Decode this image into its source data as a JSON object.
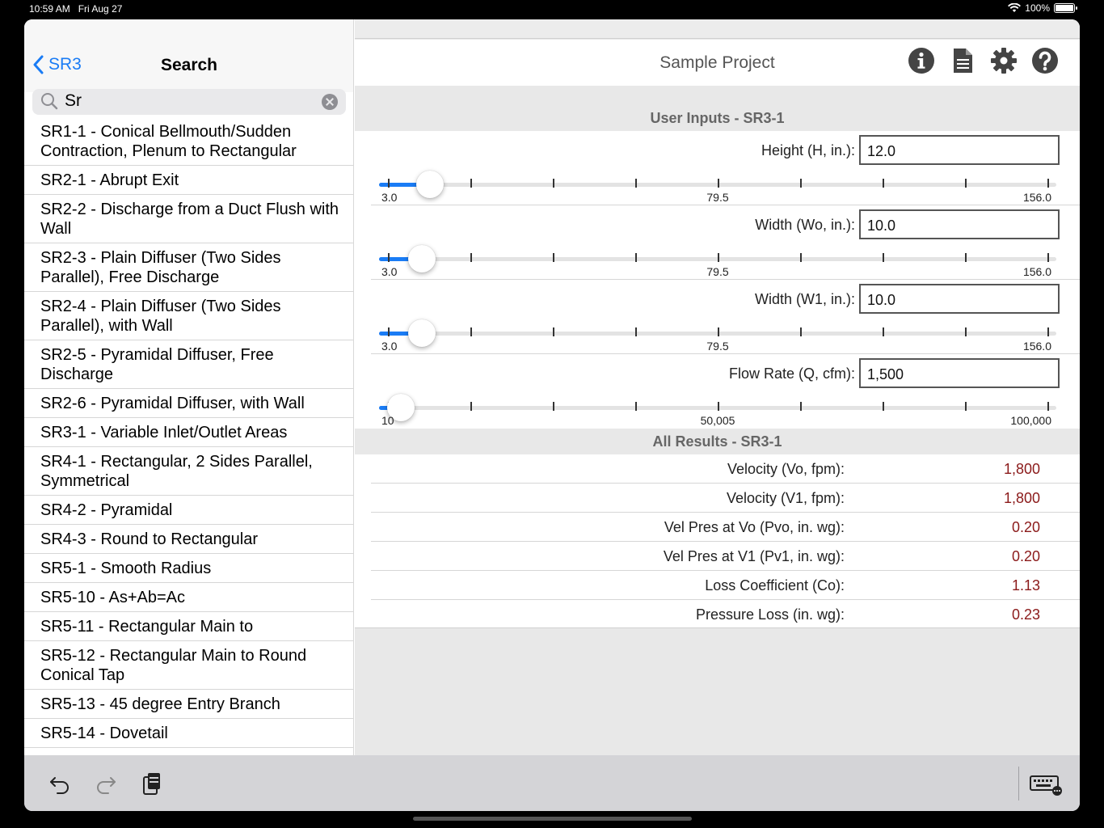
{
  "status": {
    "time": "10:59 AM",
    "date": "Fri Aug 27",
    "battery": "100%"
  },
  "sidebar": {
    "back_label": "SR3",
    "title": "Search",
    "search": {
      "value": "Sr"
    },
    "items": [
      "SR1-1 - Conical Bellmouth/Sudden Contraction, Plenum to Rectangular",
      "SR2-1 - Abrupt Exit",
      "SR2-2 - Discharge from a Duct Flush with Wall",
      "SR2-3 - Plain Diffuser (Two Sides Parallel), Free Discharge",
      "SR2-4 - Plain Diffuser (Two Sides Parallel), with Wall",
      "SR2-5 - Pyramidal Diffuser, Free Discharge",
      "SR2-6 - Pyramidal Diffuser, with Wall",
      "SR3-1 - Variable Inlet/Outlet Areas",
      "SR4-1 - Rectangular, 2 Sides Parallel, Symmetrical",
      "SR4-2 - Pyramidal",
      "SR4-3 - Round to Rectangular",
      "SR5-1 - Smooth Radius",
      "SR5-10 - As+Ab=Ac",
      "SR5-11 - Rectangular Main to",
      "SR5-12 - Rectangular Main to Round Conical Tap",
      "SR5-13 - 45 degree Entry Branch",
      "SR5-14 - Dovetail"
    ]
  },
  "main": {
    "title": "Sample Project",
    "nav_icons": [
      "info-icon",
      "document-icon",
      "gear-icon",
      "help-icon"
    ],
    "inputs_header": "User Inputs - SR3-1",
    "inputs": [
      {
        "label": "Height (H, in.):",
        "value": "12.0",
        "min": "3.0",
        "mid": "79.5",
        "max": "156.0",
        "fraction": 0.059
      },
      {
        "label": "Width (Wo, in.):",
        "value": "10.0",
        "min": "3.0",
        "mid": "79.5",
        "max": "156.0",
        "fraction": 0.046
      },
      {
        "label": "Width (W1, in.):",
        "value": "10.0",
        "min": "3.0",
        "mid": "79.5",
        "max": "156.0",
        "fraction": 0.046
      },
      {
        "label": "Flow Rate (Q, cfm):",
        "value": "1,500",
        "min": "10",
        "mid": "50,005",
        "max": "100,000",
        "fraction": 0.015
      }
    ],
    "results_header": "All Results - SR3-1",
    "results": [
      {
        "label": "Velocity (Vo, fpm):",
        "value": "1,800"
      },
      {
        "label": "Velocity (V1, fpm):",
        "value": "1,800"
      },
      {
        "label": "Vel Pres at Vo (Pvo, in. wg):",
        "value": "0.20"
      },
      {
        "label": "Vel Pres at V1 (Pv1, in. wg):",
        "value": "0.20"
      },
      {
        "label": "Loss Coefficient (Co):",
        "value": "1.13"
      },
      {
        "label": "Pressure Loss (in. wg):",
        "value": "0.23"
      }
    ]
  },
  "toolbar": {
    "icons": [
      "undo-icon",
      "redo-icon",
      "paste-icon",
      "keyboard-icon"
    ]
  },
  "colors": {
    "accent": "#1a7cf5",
    "result_value": "#8b1a1a"
  }
}
